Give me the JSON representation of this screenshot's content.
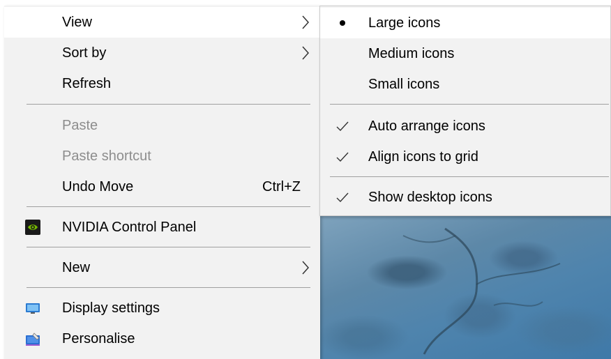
{
  "context_menu": {
    "items": [
      {
        "label": "View",
        "has_submenu": true
      },
      {
        "label": "Sort by",
        "has_submenu": true
      },
      {
        "label": "Refresh"
      },
      {
        "label": "Paste",
        "disabled": true
      },
      {
        "label": "Paste shortcut",
        "disabled": true
      },
      {
        "label": "Undo Move",
        "shortcut": "Ctrl+Z"
      },
      {
        "label": "NVIDIA Control Panel",
        "icon": "nvidia-icon"
      },
      {
        "label": "New",
        "has_submenu": true
      },
      {
        "label": "Display settings",
        "icon": "display-icon"
      },
      {
        "label": "Personalise",
        "icon": "personalise-icon"
      }
    ]
  },
  "view_submenu": {
    "items": [
      {
        "label": "Large icons",
        "mark": "bullet"
      },
      {
        "label": "Medium icons"
      },
      {
        "label": "Small icons"
      },
      {
        "label": "Auto arrange icons",
        "mark": "check"
      },
      {
        "label": "Align icons to grid",
        "mark": "check"
      },
      {
        "label": "Show desktop icons",
        "mark": "check"
      }
    ]
  },
  "colors": {
    "menu_bg": "#f2f2f2",
    "hover_bg": "#ffffff",
    "disabled_text": "#8d8d8d",
    "separator": "#a0a0a0"
  }
}
